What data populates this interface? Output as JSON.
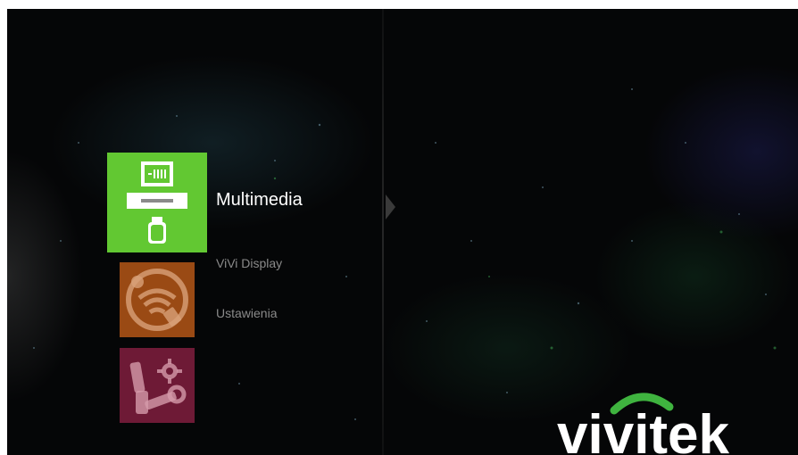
{
  "menu": {
    "items": [
      {
        "label": "Multimedia",
        "icon": "media-device-icon",
        "color": "#62c832",
        "selected": true
      },
      {
        "label": "ViVi Display",
        "icon": "wireless-display-icon",
        "color": "#9a4a14",
        "selected": false
      },
      {
        "label": "Ustawienia",
        "icon": "settings-tools-icon",
        "color": "#6e1a36",
        "selected": false
      }
    ]
  },
  "brand": {
    "logo_text": "vivitek",
    "arc_color": "#3fb33f"
  },
  "colors": {
    "background": "#050607",
    "selected_text": "#ffffff",
    "unselected_text": "#8a8a8a"
  }
}
